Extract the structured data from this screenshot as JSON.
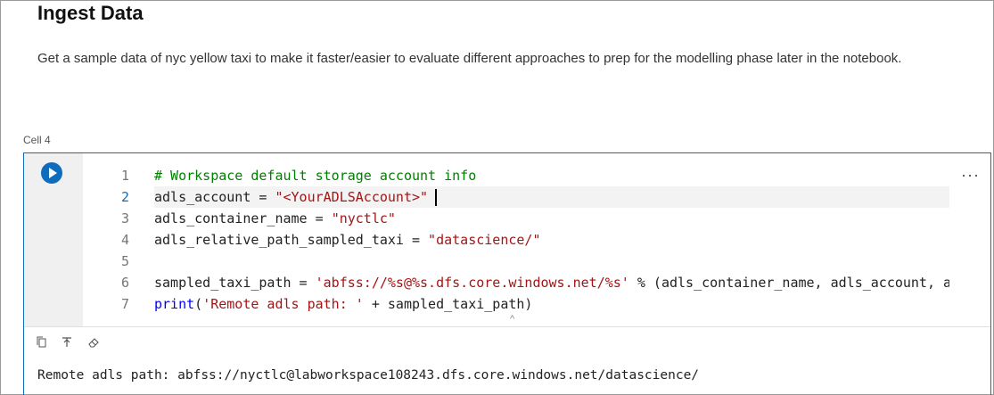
{
  "markdown": {
    "title": "Ingest Data",
    "description": "Get a sample data of nyc yellow taxi to make it faster/easier to evaluate different approaches to prep for the modelling phase later in the notebook."
  },
  "cell": {
    "label": "Cell 4",
    "active_line": 2,
    "lines": [
      {
        "num": "1",
        "parts": [
          {
            "t": "# Workspace default storage account info",
            "c": "cmt"
          }
        ]
      },
      {
        "num": "2",
        "parts": [
          {
            "t": "adls_account = ",
            "c": ""
          },
          {
            "t": "\"<YourADLSAccount>\"",
            "c": "str"
          }
        ]
      },
      {
        "num": "3",
        "parts": [
          {
            "t": "adls_container_name = ",
            "c": ""
          },
          {
            "t": "\"nyctlc\"",
            "c": "str"
          }
        ]
      },
      {
        "num": "4",
        "parts": [
          {
            "t": "adls_relative_path_sampled_taxi = ",
            "c": ""
          },
          {
            "t": "\"datascience/\"",
            "c": "str"
          }
        ]
      },
      {
        "num": "5",
        "parts": []
      },
      {
        "num": "6",
        "parts": [
          {
            "t": "sampled_taxi_path = ",
            "c": ""
          },
          {
            "t": "'abfss://%s@%s.dfs.core.windows.net/%s'",
            "c": "str"
          },
          {
            "t": " % (adls_container_name, adls_account, adls_relative_path_sampled_taxi)",
            "c": ""
          }
        ]
      },
      {
        "num": "7",
        "parts": [
          {
            "t": "print",
            "c": "kw"
          },
          {
            "t": "(",
            "c": ""
          },
          {
            "t": "'Remote adls path: '",
            "c": "str"
          },
          {
            "t": " + sampled_taxi_path)",
            "c": ""
          }
        ]
      }
    ],
    "more_label": "···",
    "output": "Remote adls path: abfss://nyctlc@labworkspace108243.dfs.core.windows.net/datascience/"
  },
  "icons": {
    "run": "run-icon",
    "copy": "copy-icon",
    "clear-format": "clear-format-icon",
    "eraser": "eraser-icon",
    "collapse": "chevron-up-icon"
  }
}
